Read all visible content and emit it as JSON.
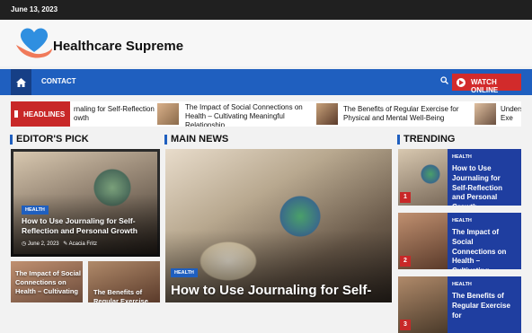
{
  "topbar": {
    "date": "June 13, 2023"
  },
  "header": {
    "site_title": "Healthcare Supreme"
  },
  "nav": {
    "contact": "CONTACT",
    "watch_online": "WATCH ONLINE"
  },
  "ticker": {
    "label": "HEADLINES",
    "items": [
      "rnaling for Self-Reflection\nowth",
      "The Impact of Social Connections on Health – Cultivating Meaningful Relationship",
      "The Benefits of Regular Exercise for Physical and Mental Well-Being",
      "Underst\nExe"
    ]
  },
  "sections": {
    "editors_pick": "EDITOR'S PICK",
    "main_news": "MAIN NEWS",
    "trending": "TRENDING"
  },
  "editors_pick": {
    "main": {
      "category": "HEALTH",
      "title": "How to Use Journaling for Self-Reflection and Personal Growth",
      "date": "June 2, 2023",
      "author": "Acacia Fritz"
    },
    "small": [
      {
        "title": "The Impact of Social Connections on Health – Cultivating"
      },
      {
        "title": "The Benefits of Regular Exercise"
      }
    ]
  },
  "main_news": {
    "category": "HEALTH",
    "title": "How to Use Journaling for Self-"
  },
  "trending": [
    {
      "num": "1",
      "category": "HEALTH",
      "title": "How to Use Journaling for Self-Reflection and Personal Growth"
    },
    {
      "num": "2",
      "category": "HEALTH",
      "title": "The Impact of Social Connections on Health – Cultivating Meaningful"
    },
    {
      "num": "3",
      "category": "HEALTH",
      "title": "The Benefits of Regular Exercise for"
    }
  ],
  "colors": {
    "accent_blue": "#1f5fbf",
    "accent_red": "#c82828",
    "dark": "#202020"
  },
  "icons": {
    "home": "home-icon",
    "search": "search-icon",
    "play": "play-icon",
    "logo": "heart-hands-logo"
  }
}
